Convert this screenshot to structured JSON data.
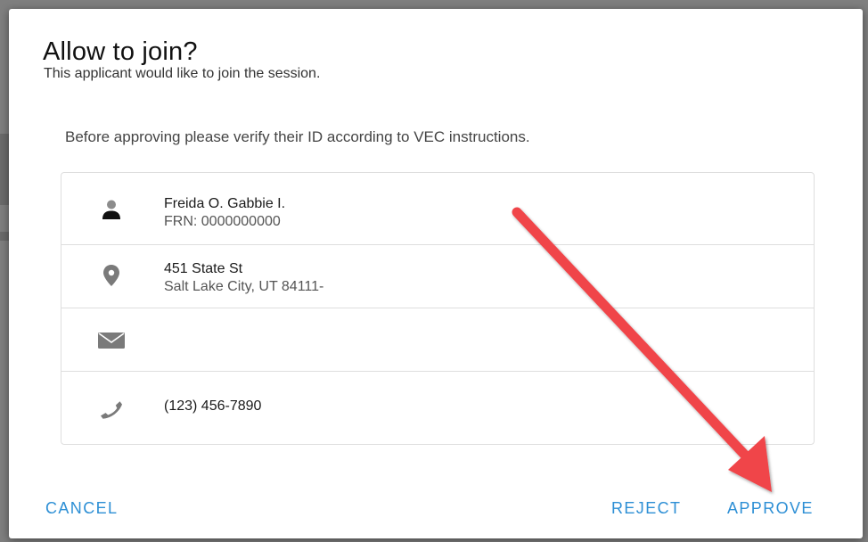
{
  "dialog": {
    "title": "Allow to join?",
    "subtitle": "This applicant would like to join the session.",
    "instructions": "Before approving please verify their ID according to VEC instructions."
  },
  "applicant": {
    "name": "Freida O. Gabbie I.",
    "frn": "FRN: 0000000000",
    "address_line1": "451 State St",
    "address_line2": "Salt Lake City, UT 84111-",
    "email": "",
    "phone": "(123) 456-7890"
  },
  "icons": {
    "person": "person-icon",
    "location": "location-pin-icon",
    "email": "envelope-icon",
    "phone": "phone-icon"
  },
  "actions": {
    "cancel_label": "CANCEL",
    "reject_label": "REJECT",
    "approve_label": "APPROVE"
  },
  "colors": {
    "accent": "#2d8fd5",
    "annotation_arrow": "#f0444a",
    "icon_gray": "#777777"
  }
}
